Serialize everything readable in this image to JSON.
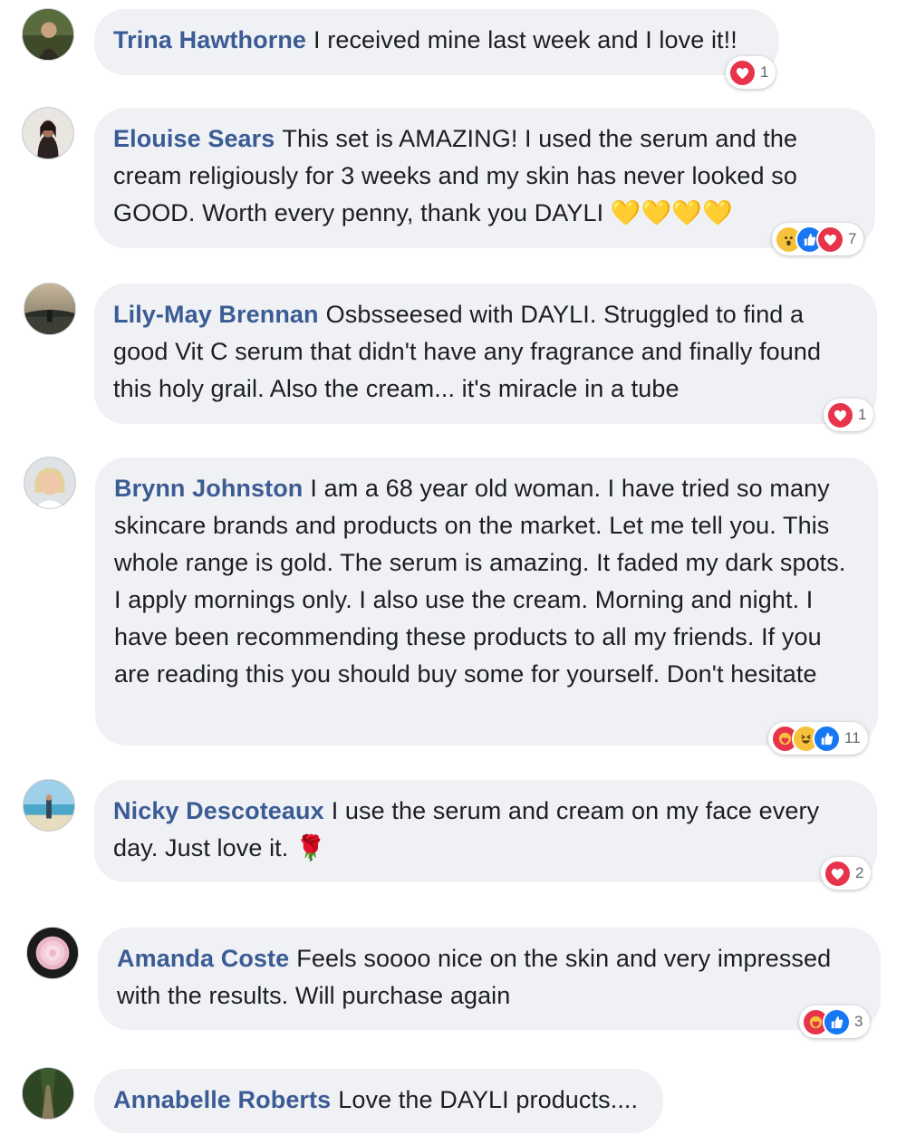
{
  "comments": [
    {
      "author": "Trina Hawthorne",
      "text": "I received mine last week and I love it!!",
      "reactions": [
        "love"
      ],
      "reaction_count": "1"
    },
    {
      "author": "Elouise Sears",
      "text": "This set is AMAZING! I used the serum and the cream religiously for 3 weeks and my skin has never looked so GOOD. Worth every penny, thank you DAYLI 💛💛💛💛",
      "reactions": [
        "wow",
        "like",
        "love"
      ],
      "reaction_count": "7"
    },
    {
      "author": "Lily-May Brennan",
      "text": "Osbsseesed with DAYLI. Struggled to find a good Vit C serum that didn't have any fragrance and finally found this holy grail. Also the cream... it's miracle in a tube",
      "reactions": [
        "love"
      ],
      "reaction_count": "1"
    },
    {
      "author": "Brynn Johnston",
      "text": "I am a 68 year old woman. I have tried so many skincare brands and products on the market. Let me tell you. This whole range is gold. The serum is amazing. It faded my dark spots. I apply mornings only. I also use the cream. Morning and night. I have been recommending these products to all my friends. If you are reading this you should buy some for yourself. Don't hesitate",
      "reactions": [
        "care",
        "haha",
        "like"
      ],
      "reaction_count": "11"
    },
    {
      "author": "Nicky Descoteaux",
      "text": "I use the serum and cream on my face every day. Just love it. 🌹",
      "reactions": [
        "love"
      ],
      "reaction_count": "2"
    },
    {
      "author": "Amanda Coste",
      "text": "Feels soooo nice on the skin and very impressed with the results. Will purchase again",
      "reactions": [
        "care",
        "like"
      ],
      "reaction_count": "3"
    },
    {
      "author": "Annabelle Roberts",
      "text": "Love the DAYLI products....",
      "reactions": [],
      "reaction_count": ""
    }
  ],
  "colors": {
    "bubble": "#eff1f4",
    "author": "#3b5b95",
    "love": "#e8344b",
    "like": "#1877f2",
    "yellow": "#f5c33b"
  }
}
